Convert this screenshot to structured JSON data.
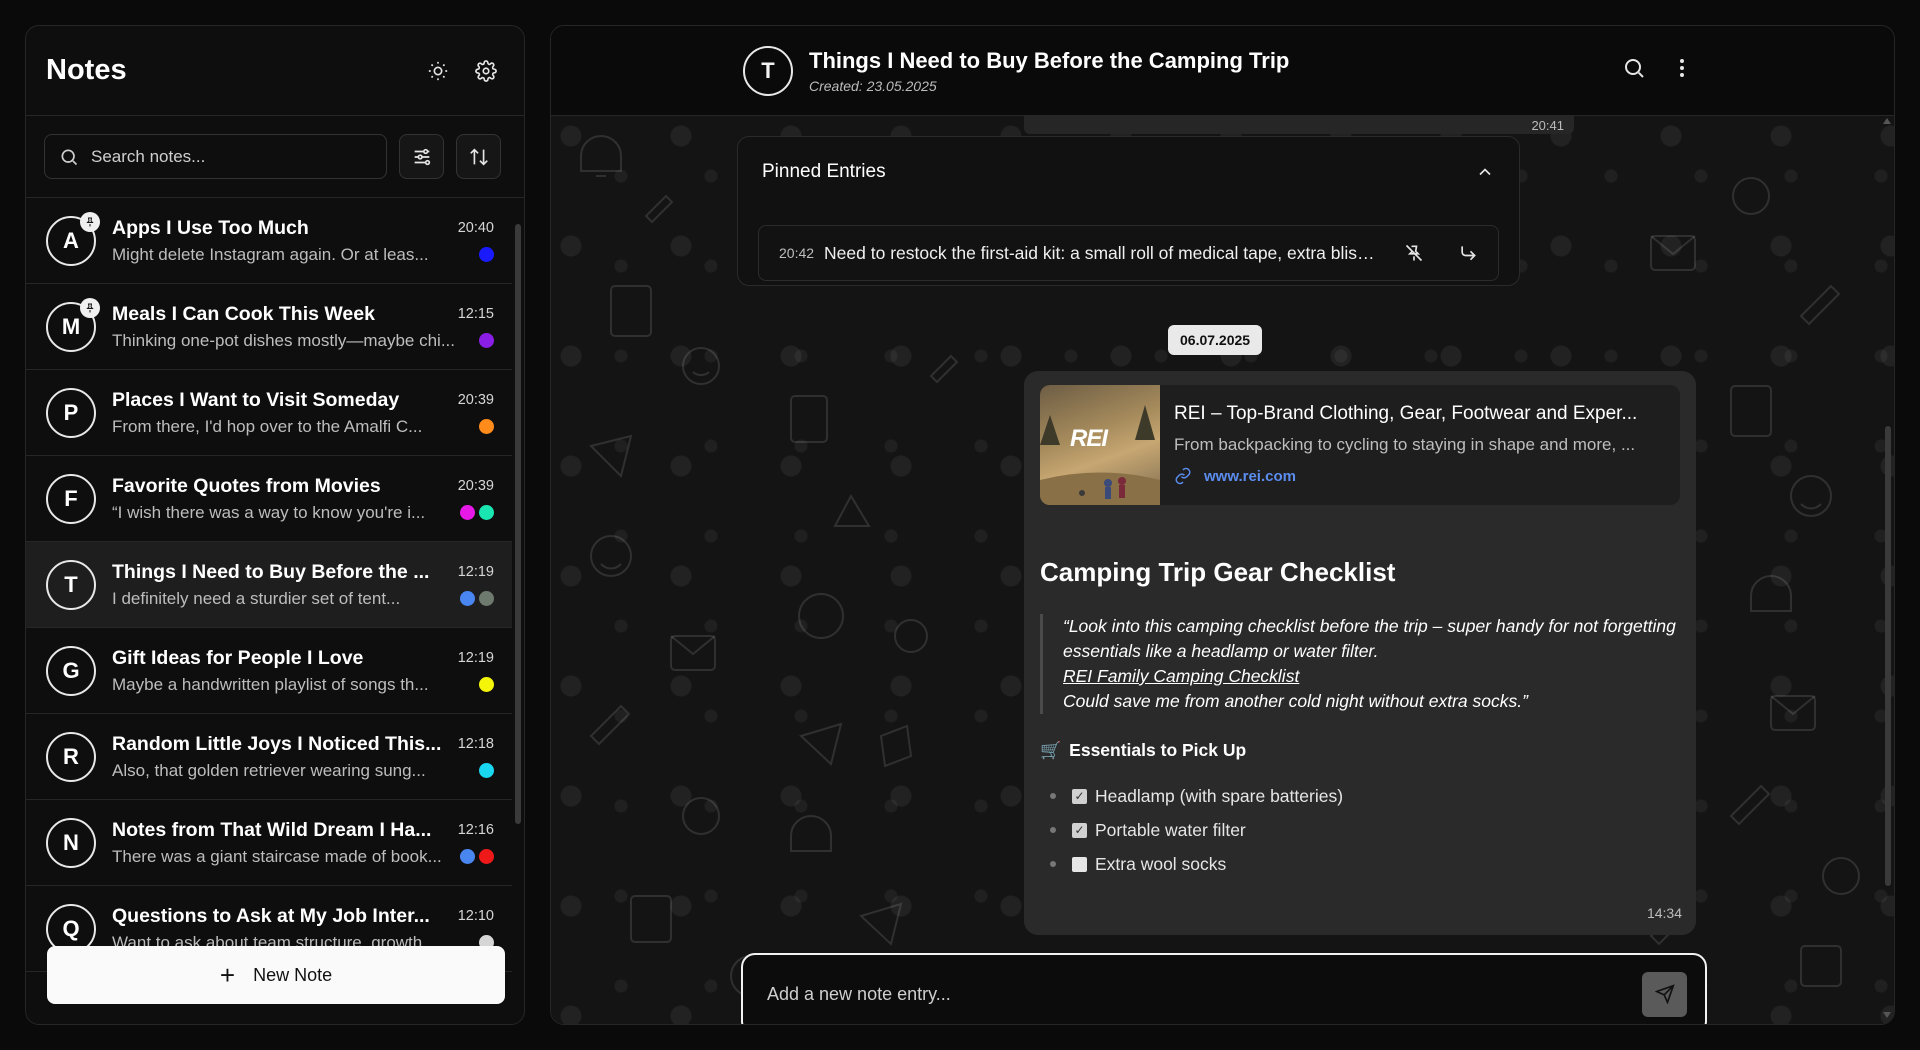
{
  "sidebar": {
    "title": "Notes",
    "search_placeholder": "Search notes...",
    "new_note_label": "New Note",
    "notes": [
      {
        "initial": "A",
        "title": "Apps I Use Too Much",
        "time": "20:40",
        "preview": "Might delete Instagram again. Or at leas...",
        "pinned": true,
        "colors": [
          "#1a1aff"
        ]
      },
      {
        "initial": "M",
        "title": "Meals I Can Cook This Week",
        "time": "12:15",
        "preview": "Thinking one-pot dishes mostly—maybe chi...",
        "pinned": true,
        "colors": [
          "#8a1ee6"
        ]
      },
      {
        "initial": "P",
        "title": "Places I Want to Visit Someday",
        "time": "20:39",
        "preview": "From there, I'd hop over to the Amalfi C...",
        "pinned": false,
        "colors": [
          "#ff8c1a"
        ]
      },
      {
        "initial": "F",
        "title": "Favorite Quotes from Movies",
        "time": "20:39",
        "preview": "“I wish there was a way to know you're i...",
        "pinned": false,
        "colors": [
          "#e619e6",
          "#19e6b0"
        ]
      },
      {
        "initial": "T",
        "title": "Things I Need to Buy Before the ...",
        "time": "12:19",
        "preview": "I definitely need a sturdier set of tent...",
        "pinned": false,
        "active": true,
        "colors": [
          "#4a86f0",
          "#6e7a6e"
        ]
      },
      {
        "initial": "G",
        "title": "Gift Ideas for People I Love",
        "time": "12:19",
        "preview": "Maybe a handwritten playlist of songs th...",
        "pinned": false,
        "colors": [
          "#f5f50a"
        ]
      },
      {
        "initial": "R",
        "title": "Random Little Joys I Noticed This...",
        "time": "12:18",
        "preview": "Also, that golden retriever wearing sung...",
        "pinned": false,
        "colors": [
          "#19d7f0"
        ]
      },
      {
        "initial": "N",
        "title": "Notes from That Wild Dream I Ha...",
        "time": "12:16",
        "preview": "There was a giant staircase made of book...",
        "pinned": false,
        "colors": [
          "#4a86f0",
          "#f01919"
        ]
      },
      {
        "initial": "Q",
        "title": "Questions to Ask at My Job Inter...",
        "time": "12:10",
        "preview": "Want to ask about team structure, growth...",
        "pinned": false,
        "colors": [
          "#d6d6d6"
        ]
      }
    ]
  },
  "main": {
    "avatar_initial": "T",
    "title": "Things I Need to Buy Before the Camping Trip",
    "created": "Created: 23.05.2025",
    "prev_time": "20:41",
    "pinned": {
      "title": "Pinned Entries",
      "entry_time": "20:42",
      "entry_text": "Need to restock the first-aid kit: a small roll of medical tape, extra blister b..."
    },
    "date_chip": "06.07.2025",
    "entry": {
      "link_title": "REI – Top-Brand Clothing, Gear, Footwear and Exper...",
      "link_desc": "From backpacking to cycling to staying in shape and more, ...",
      "link_url": "www.rei.com",
      "thumb_logo": "REI",
      "heading": "Camping Trip Gear Checklist",
      "quote_line1": "“Look into this camping checklist before the trip – super handy for not forgetting essentials like a headlamp or water filter.",
      "quote_link": "REI Family Camping Checklist",
      "quote_line2": "Could save me from another cold night without extra socks.”",
      "section_title": "Essentials to Pick Up",
      "items": [
        {
          "label": "Headlamp (with spare batteries)",
          "checked": true
        },
        {
          "label": "Portable water filter",
          "checked": true
        },
        {
          "label": "Extra wool socks",
          "checked": false
        }
      ],
      "time": "14:34"
    },
    "composer_placeholder": "Add a new note entry..."
  }
}
